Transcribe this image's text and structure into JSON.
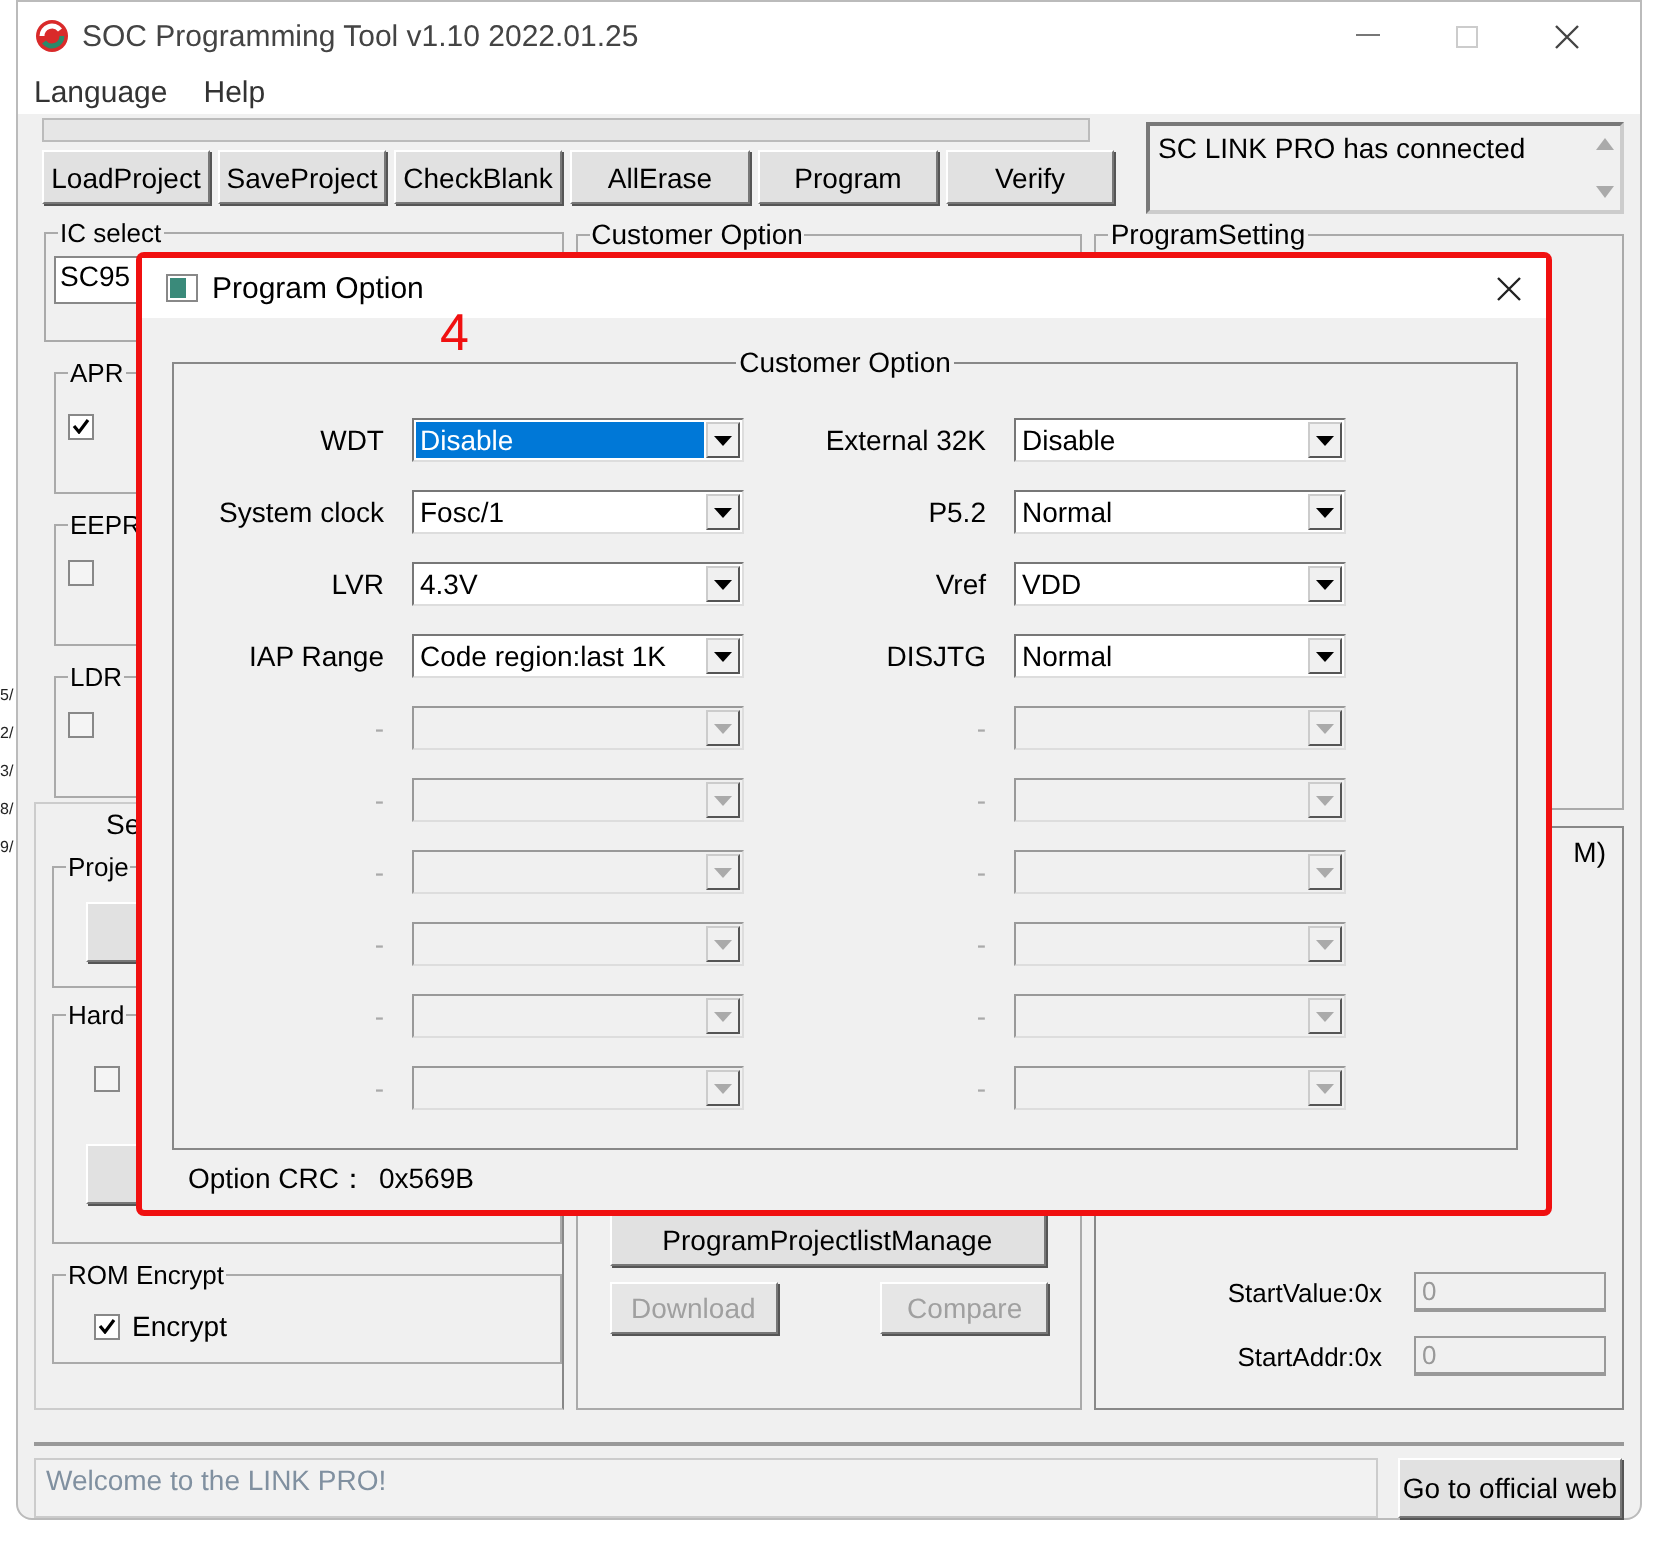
{
  "window": {
    "title": "SOC Programming Tool v1.10 2022.01.25"
  },
  "menu": [
    "Language",
    "Help"
  ],
  "toolbar": [
    "LoadProject",
    "SaveProject",
    "CheckBlank",
    "AllErase",
    "Program",
    "Verify"
  ],
  "progress": {
    "level": 0
  },
  "connection_log": "SC LINK PRO has connected",
  "edge_fragments": [
    "5/",
    "2/",
    "3/",
    "8/",
    "9/"
  ],
  "left_panel": {
    "ic_select": {
      "label": "IC select",
      "value": "SC95"
    },
    "groups": [
      {
        "label": "APR",
        "checked": true
      },
      {
        "label": "EEPR",
        "checked": false
      },
      {
        "label": "LDR",
        "checked": false
      }
    ],
    "settings_tab": "Se",
    "project_group": "Proje",
    "hardware_group": {
      "label": "Hard",
      "checkbox": {
        "checked": false
      }
    },
    "rom_encrypt": {
      "label": "ROM Encrypt",
      "checkbox": {
        "label": "Encrypt",
        "checked": true
      }
    }
  },
  "customer_option_group": "Customer Option",
  "program_setting_group": "ProgramSetting",
  "middle_buttons": [
    {
      "label": "ProgramProjectlistManage",
      "disabled": false
    },
    {
      "label": "Download",
      "disabled": true
    },
    {
      "label": "Compare",
      "disabled": true
    }
  ],
  "right_group": {
    "label": "M)",
    "fields": [
      {
        "label": "StartValue:0x",
        "value": "0",
        "disabled": true
      },
      {
        "label": "StartAddr:0x",
        "value": "0",
        "disabled": true
      }
    ]
  },
  "status": {
    "message": "Welcome to the LINK PRO!"
  },
  "web_button": "Go to official web",
  "dialog": {
    "title": "Program Option",
    "annotation": "4",
    "group": "Customer Option",
    "rows": [
      {
        "left": {
          "label": "WDT",
          "value": "Disable",
          "disabled": false,
          "focused": true
        },
        "right": {
          "label": "External 32K",
          "value": "Disable",
          "disabled": false,
          "focused": false
        }
      },
      {
        "left": {
          "label": "System clock",
          "value": "Fosc/1",
          "disabled": false,
          "focused": false
        },
        "right": {
          "label": "P5.2",
          "value": "Normal",
          "disabled": false,
          "focused": false
        }
      },
      {
        "left": {
          "label": "LVR",
          "value": "4.3V",
          "disabled": false,
          "focused": false
        },
        "right": {
          "label": "Vref",
          "value": "VDD",
          "disabled": false,
          "focused": false
        }
      },
      {
        "left": {
          "label": "IAP Range",
          "value": "Code region:last 1K",
          "disabled": false,
          "focused": false
        },
        "right": {
          "label": "DISJTG",
          "value": "Normal",
          "disabled": false,
          "focused": false
        }
      },
      {
        "left": {
          "label": "-",
          "disabled": true
        },
        "right": {
          "label": "-",
          "disabled": true
        }
      },
      {
        "left": {
          "label": "-",
          "disabled": true
        },
        "right": {
          "label": "-",
          "disabled": true
        }
      },
      {
        "left": {
          "label": "-",
          "disabled": true
        },
        "right": {
          "label": "-",
          "disabled": true
        }
      },
      {
        "left": {
          "label": "-",
          "disabled": true
        },
        "right": {
          "label": "-",
          "disabled": true
        }
      },
      {
        "left": {
          "label": "-",
          "disabled": true
        },
        "right": {
          "label": "-",
          "disabled": true
        }
      },
      {
        "left": {
          "label": "-",
          "disabled": true
        },
        "right": {
          "label": "-",
          "disabled": true
        }
      }
    ],
    "crc_label": "Option CRC：",
    "crc_value": "0x569B"
  }
}
